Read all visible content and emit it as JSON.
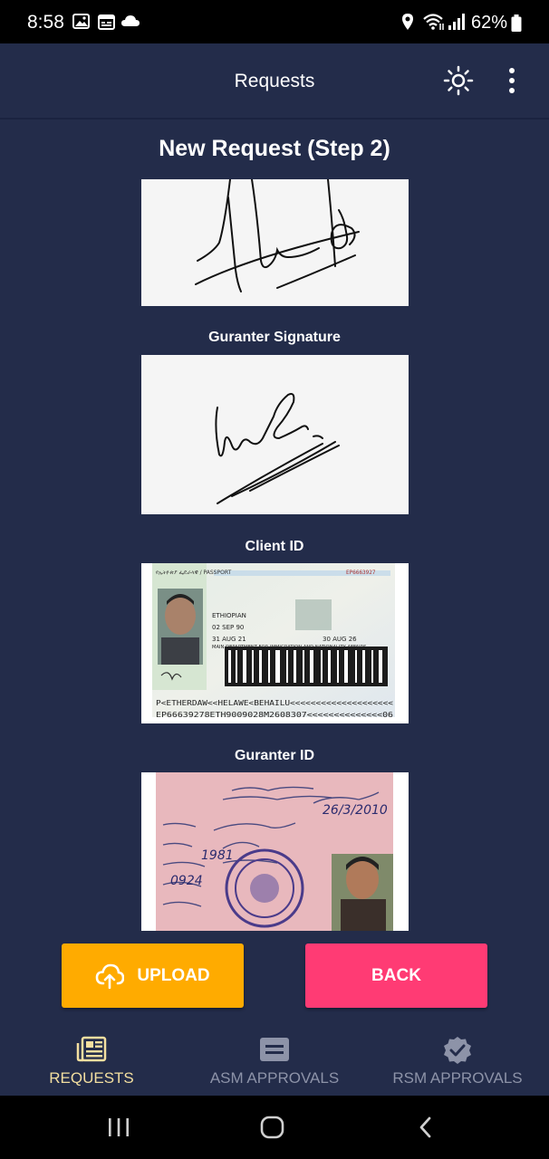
{
  "status": {
    "time": "8:58",
    "battery": "62%"
  },
  "appbar": {
    "title": "Requests",
    "theme_icon": "sun-icon",
    "menu_icon": "more-vertical-icon"
  },
  "page": {
    "heading": "New Request (Step 2)",
    "sections": [
      {
        "label": ""
      },
      {
        "label": "Guranter Signature"
      },
      {
        "label": "Client ID"
      },
      {
        "label": "Guranter ID"
      }
    ]
  },
  "passport": {
    "header": "የኢትዮጵያ ፌዴራላዊ / PASSPORT",
    "number": "EP6663927",
    "lines": [
      "ETHIOPIAN",
      "02 SEP 90",
      "31 AUG 21",
      "30 AUG 26",
      "MAIN DEPARTMENT FOR IMMIGRATION AND NATIONALITY AFFAIRS"
    ],
    "mrz1": "P<ETHERDAW<<HELAWE<BEHAILU<<<<<<<<<<<<<<<<<<<<",
    "mrz2": "EP66639278ETH9009028M2608307<<<<<<<<<<<<<<06"
  },
  "actions": {
    "upload": "UPLOAD",
    "back": "BACK"
  },
  "nav": [
    {
      "label": "REQUESTS",
      "active": true
    },
    {
      "label": "ASM APPROVALS",
      "active": false
    },
    {
      "label": "RSM APPROVALS",
      "active": false
    }
  ],
  "colors": {
    "background": "#232c4a",
    "upload": "#ffab00",
    "back": "#ff3b74",
    "nav_active": "#f3dfa0",
    "nav_inactive": "#8d93a8"
  }
}
